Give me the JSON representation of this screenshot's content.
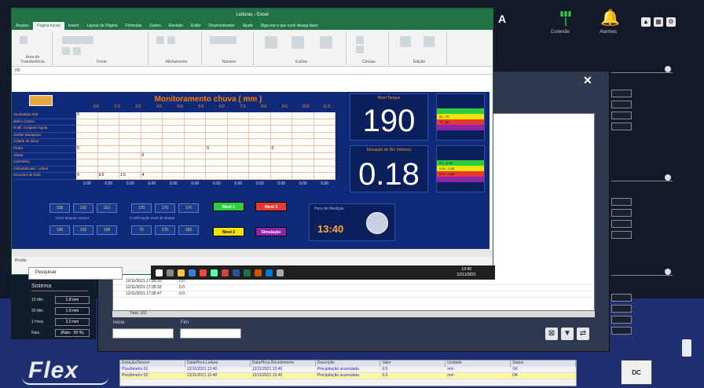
{
  "excel": {
    "title": "Leituras - Excel",
    "tabs": [
      "Arquivo",
      "Página Inicial",
      "Inserir",
      "Layout da Página",
      "Fórmulas",
      "Dados",
      "Revisão",
      "Exibir",
      "Desenvolvedor",
      "Ajuda",
      "Diga-me o que você deseja fazer"
    ],
    "active_tab": 1,
    "ribbon_groups": [
      "Área de Transferência",
      "Fonte",
      "Alinhamento",
      "Número",
      "Estilos",
      "Células",
      "Edição"
    ],
    "formula_bar": "H5"
  },
  "dashboard": {
    "title": "Monitoramento chuva  ( mm )",
    "hours": [
      "0:0",
      "1:0",
      "2:0",
      "3:0",
      "4:0",
      "5:0",
      "6:0",
      "7:0",
      "8:0",
      "9:0",
      "10:0",
      "11:0",
      "12:0"
    ],
    "row_labels": [
      "Acumulado 24h",
      "Bairro Centro",
      "R.Mil. Conjunto Aguia",
      "Jardim Marajoara",
      "Cidade de Deus",
      "Pedra",
      "Olaria",
      "Cachoeira",
      "Camanducaia - Leitoa",
      "Encontro de Rios"
    ],
    "cell_values": [
      [
        "0",
        "",
        "",
        "",
        "",
        "",
        "",
        "",
        "",
        "",
        "",
        ""
      ],
      [
        "",
        "",
        "",
        "",
        "",
        "",
        "",
        "",
        "",
        "",
        "",
        ""
      ],
      [
        "",
        "",
        "",
        "",
        "",
        "",
        "",
        "",
        "",
        "",
        "",
        ""
      ],
      [
        "",
        "",
        "",
        "",
        "",
        "",
        "",
        "",
        "",
        "",
        "",
        ""
      ],
      [
        "",
        "",
        "",
        "",
        "",
        "",
        "",
        "",
        "",
        "",
        "",
        ""
      ],
      [
        "0",
        "",
        "",
        "",
        "",
        "",
        "0",
        "",
        "",
        "0",
        "",
        ""
      ],
      [
        "",
        "",
        "",
        "0",
        "",
        "",
        "",
        "",
        "",
        "",
        "",
        ""
      ],
      [
        "",
        "",
        "",
        "",
        "",
        "",
        "",
        "",
        "",
        "",
        "",
        ""
      ],
      [
        "",
        "",
        "",
        "",
        "",
        "",
        "",
        "",
        "",
        "",
        "",
        ""
      ],
      [
        "9",
        "9.5",
        "1.5",
        "4",
        "",
        "",
        "",
        "",
        "",
        "",
        "",
        ""
      ]
    ],
    "totals": [
      "0.00",
      "0.00",
      "0.00",
      "0.00",
      "0.00",
      "0.00",
      "0.00",
      "0.00",
      "0.00",
      "0.00",
      "0.00",
      "0.00"
    ],
    "big_value_1_label": "Nível Tanque",
    "big_value_1": "190",
    "big_value_2_label": "Elevação do Rio (metros)",
    "big_value_2": "0.18",
    "scale_1": [
      {
        "label": "",
        "color": "#2ecc40"
      },
      {
        "label": "61 - 70",
        "color": "#f1e20c"
      },
      {
        "label": "71 - 90",
        "color": "#e53935"
      },
      {
        "label": "",
        "color": "#8e24aa"
      }
    ],
    "scale_2": [
      {
        "label": "0.1 - 0.39",
        "color": "#2ecc40"
      },
      {
        "label": "0.40 - 0.69",
        "color": "#f1e20c"
      },
      {
        "label": "0.70 - 0.99",
        "color": "#e53935"
      },
      {
        "label": "",
        "color": "#8e24aa"
      }
    ],
    "mini_boxes_1": [
      "106",
      "102",
      "110"
    ],
    "mini_label_1": "Nível tanques sensor",
    "mini_boxes_1b": [
      "196",
      "192",
      "108"
    ],
    "mini_boxes_2": [
      "170",
      "170",
      "170"
    ],
    "mini_label_2": "Confirmação nível de tanque",
    "mini_boxes_2b": [
      "70",
      "170",
      "160"
    ],
    "buttons": {
      "green": "Nível 1",
      "red": "Nível 3",
      "yellow": "Nível 2",
      "purple": "Simulação"
    },
    "hora_label": "Hora de Medição",
    "hora": "13:40"
  },
  "status": {
    "sheet": "Pronto"
  },
  "taskbar": {
    "time": "13:40",
    "date": "12/11/2021"
  },
  "search_popup": "Pesquisar",
  "app": {
    "letter": "A",
    "connection_label": "Conexão",
    "alarm_label": "Alarmes",
    "list_rows": [
      {
        "time": "12/11/2021 17:35:10",
        "value": "0.0"
      },
      {
        "time": "12/11/2021 17:35:33",
        "value": "0.0"
      },
      {
        "time": "12/11/2021 17:35:47",
        "value": "0.0"
      }
    ],
    "footer": "Total: 162",
    "field_1_label": "Início",
    "field_2_label": "Fim",
    "left_panel": {
      "header": "Sistema",
      "rows": [
        {
          "k": "10 Min",
          "v": "1.8 mm"
        },
        {
          "k": "30 Min",
          "v": "1.9 mm"
        },
        {
          "k": "1 Hora",
          "v": "2.0 mm"
        },
        {
          "k": "Raio",
          "v": "(Rain - 50 %)"
        }
      ]
    }
  },
  "bottom_table": {
    "headers": [
      "Estação/Sensor",
      "Data/Hora Leitura",
      "Data/Hora Recebimento",
      "Descrição",
      "Valor",
      "Unidade",
      "Status"
    ],
    "rows": [
      [
        "Pluviômetro 01",
        "12/11/2021 13:40",
        "12/11/2021 13:40",
        "Precipitação acumulada",
        "0.0",
        "mm",
        "OK"
      ],
      [
        "Pluviômetro 02",
        "12/11/2021 13:40",
        "12/11/2021 13:40",
        "Precipitação acumulada",
        "0.0",
        "mm",
        "OK"
      ]
    ]
  },
  "logo": {
    "text": "Flex"
  },
  "badge": "DC"
}
